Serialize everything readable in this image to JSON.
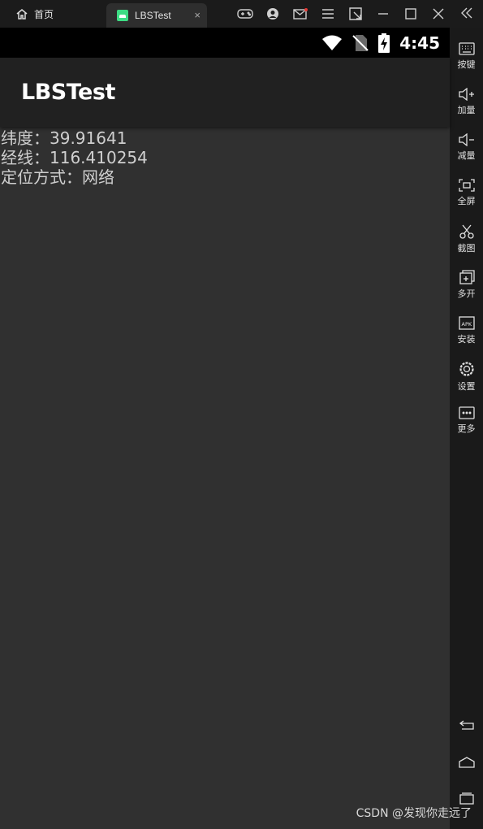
{
  "emulator": {
    "home_tab": "首页",
    "app_tab": "LBSTest",
    "close_glyph": "×"
  },
  "statusbar": {
    "time": "4:45"
  },
  "app": {
    "title": "LBSTest",
    "lines": [
      "纬度：39.91641",
      "经线：116.410254",
      "定位方式：网络"
    ]
  },
  "sidebar": {
    "items": [
      {
        "label": "按键",
        "icon": "keyboard-icon"
      },
      {
        "label": "加量",
        "icon": "volume-up-icon"
      },
      {
        "label": "减量",
        "icon": "volume-down-icon"
      },
      {
        "label": "全屏",
        "icon": "fullscreen-icon"
      },
      {
        "label": "截图",
        "icon": "scissors-icon"
      },
      {
        "label": "多开",
        "icon": "multi-instance-icon"
      },
      {
        "label": "安装",
        "icon": "apk-icon"
      },
      {
        "label": "设置",
        "icon": "gear-icon"
      },
      {
        "label": "更多",
        "icon": "more-icon"
      }
    ]
  },
  "watermark": "CSDN @发现你走远了"
}
